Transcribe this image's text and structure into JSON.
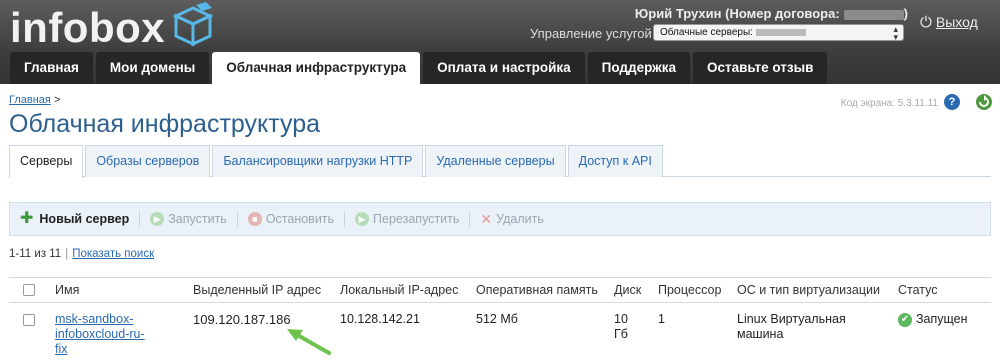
{
  "header": {
    "logo": "infobox",
    "user": "Юрий Трухин (Номер договора:",
    "user_close": ")",
    "services_label": "Управление услугой",
    "services_value": "Облачные серверы:",
    "logout": "Выход"
  },
  "nav": [
    "Главная",
    "Мои домены",
    "Облачная инфраструктура",
    "Оплата и настройка",
    "Поддержка",
    "Оставьте отзыв"
  ],
  "breadcrumb": {
    "home": "Главная",
    "sep": ">"
  },
  "screen_code": "Код экрана: 5.3.11.11",
  "help": "?",
  "page_title": "Облачная инфраструктура",
  "subtabs": [
    "Серверы",
    "Образы серверов",
    "Балансировщики нагрузки HTTP",
    "Удаленные серверы",
    "Доступ к API"
  ],
  "toolbar": {
    "new": "Новый сервер",
    "start": "Запустить",
    "stop": "Остановить",
    "restart": "Перезапустить",
    "delete": "Удалить"
  },
  "pager": {
    "range": "1-11 из 11",
    "search": "Показать поиск"
  },
  "table": {
    "headers": [
      "Имя",
      "Выделенный IP адрес",
      "Локальный IP-адрес",
      "Оперативная память",
      "Диск",
      "Процессор",
      "ОС и тип виртуализации",
      "Статус"
    ],
    "rows": [
      {
        "name_1": "msk-sandbox-",
        "name_2": "infoboxcloud-ru-",
        "name_3": "fix",
        "ip": "109.120.187.186",
        "local_ip": "10.128.142.21",
        "ram": "512 Мб",
        "disk_1": "10",
        "disk_2": "Гб",
        "cpu": "1",
        "os_1": "Linux Виртуальная",
        "os_2": "машина",
        "status": "Запущен"
      }
    ]
  },
  "colors": {
    "accent": "#2a6ab1",
    "arrow": "#6cc24a",
    "nav_bg": "#262626"
  }
}
